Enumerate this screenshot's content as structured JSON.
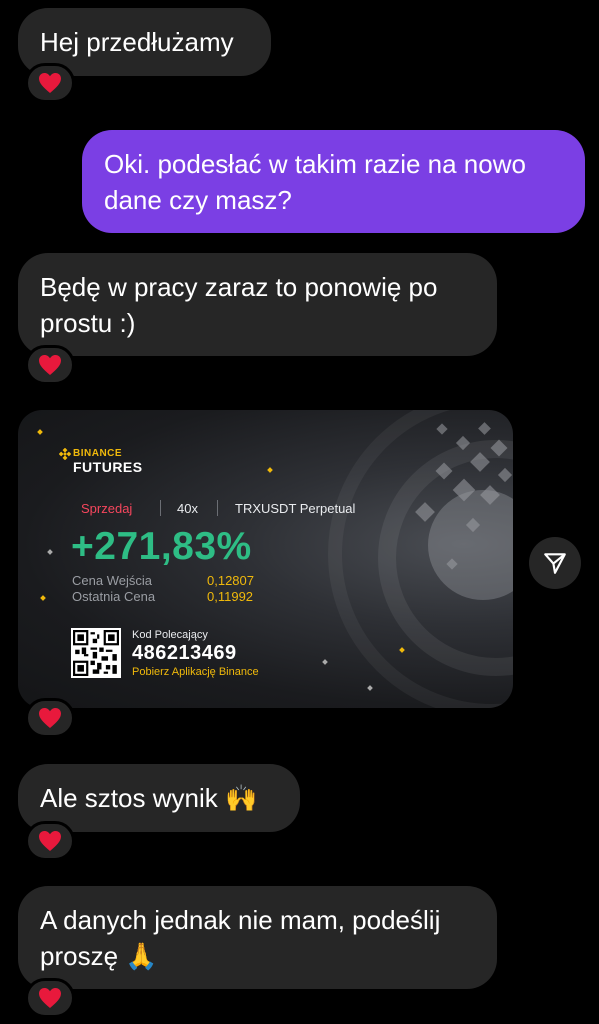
{
  "messages": [
    {
      "id": "m1",
      "text": "Hej przedłużamy"
    },
    {
      "id": "m2",
      "text_lines": [
        "Oki. podesłać w takim razie na nowo",
        "dane czy masz?"
      ]
    },
    {
      "id": "m3",
      "text_lines": [
        "Będę w pracy zaraz to ponowię po",
        "prostu :)"
      ]
    },
    {
      "id": "m5",
      "text": "Ale sztos wynik 🙌"
    },
    {
      "id": "m6",
      "text_lines": [
        "A danych jednak nie mam, podeślij",
        "proszę 🙏"
      ]
    }
  ],
  "card": {
    "brand_top": "BINANCE",
    "brand_bottom": "FUTURES",
    "side": "Sprzedaj",
    "leverage": "40x",
    "pair": "TRXUSDT Perpetual",
    "pnl": "+271,83%",
    "entry_label": "Cena Wejścia",
    "entry_value": "0,12807",
    "last_label": "Ostatnia Cena",
    "last_value": "0,11992",
    "referral_label": "Kod Polecający",
    "referral_code": "486213469",
    "download_text": "Pobierz Aplikację Binance"
  },
  "reaction_icon": "red-heart-icon",
  "share_icon": "paper-plane-icon",
  "colors": {
    "outgoing_bubble": "#7b3fe4",
    "incoming_bubble": "#262626",
    "pnl_green": "#2ebd85",
    "sell_red": "#f6465d",
    "binance_yellow": "#f0b90b"
  }
}
